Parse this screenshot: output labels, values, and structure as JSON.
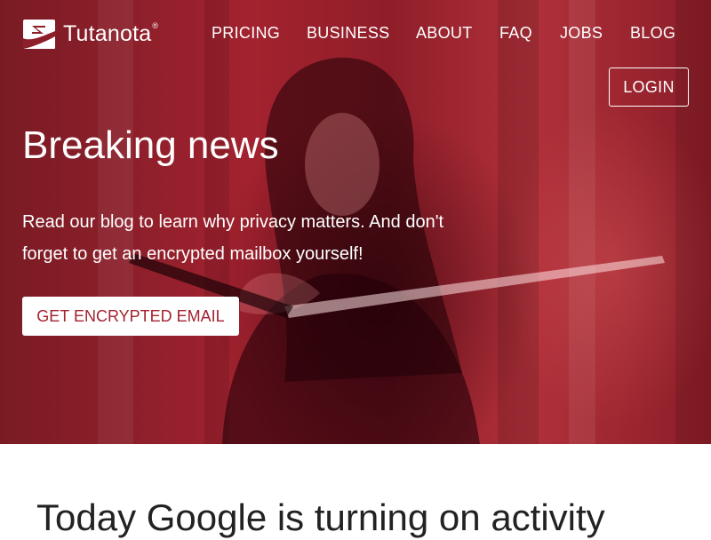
{
  "brand": {
    "name": "Tutanota",
    "registered_mark": "®"
  },
  "nav": {
    "items": [
      {
        "label": "PRICING"
      },
      {
        "label": "BUSINESS"
      },
      {
        "label": "ABOUT"
      },
      {
        "label": "FAQ"
      },
      {
        "label": "JOBS"
      },
      {
        "label": "BLOG"
      }
    ],
    "login_label": "LOGIN"
  },
  "hero": {
    "headline": "Breaking news",
    "lead": "Read our blog to learn why privacy matters. And don't forget to get an encrypted mailbox yourself!",
    "cta_label": "GET ENCRYPTED EMAIL"
  },
  "article": {
    "title": "Today Google is turning on activity"
  },
  "colors": {
    "brand_red": "#a3222f",
    "text_dark": "#222222",
    "white": "#ffffff"
  }
}
